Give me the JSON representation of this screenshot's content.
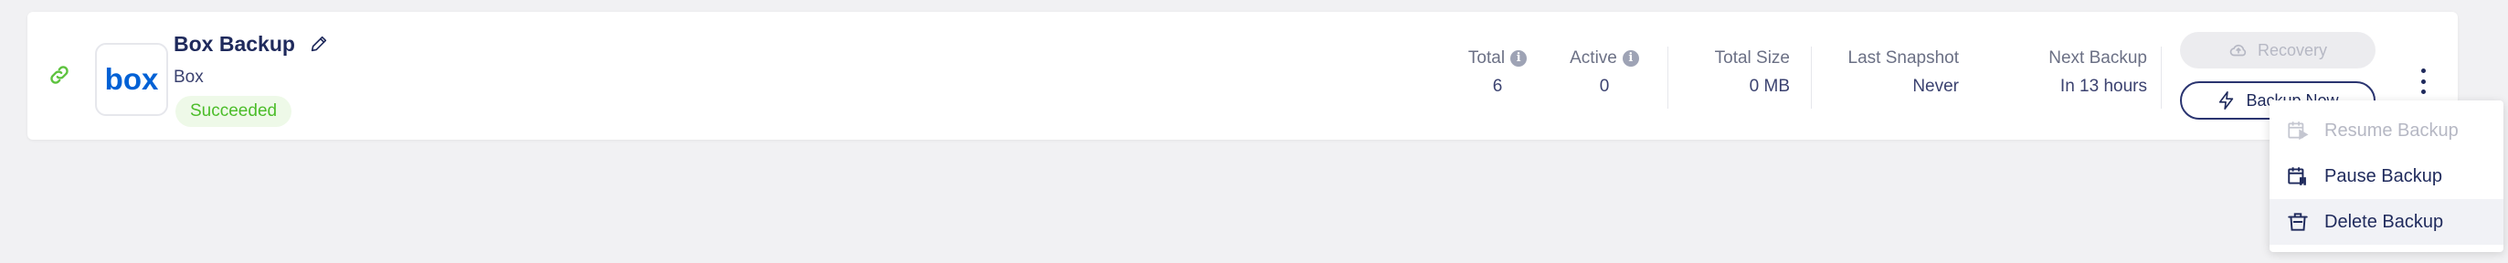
{
  "app": {
    "title": "Box Backup",
    "subtitle": "Box",
    "status": "Succeeded",
    "logo_text": "box"
  },
  "stats": {
    "total": {
      "label": "Total",
      "value": "6"
    },
    "active": {
      "label": "Active",
      "value": "0"
    },
    "total_size": {
      "label": "Total Size",
      "value": "0 MB"
    },
    "last_snapshot": {
      "label": "Last Snapshot",
      "value": "Never"
    },
    "next_backup": {
      "label": "Next Backup",
      "value": "In 13 hours"
    }
  },
  "actions": {
    "recovery_label": "Recovery",
    "backup_now_label": "Backup Now"
  },
  "menu": {
    "items": [
      {
        "label": "Resume Backup",
        "icon": "resume-icon",
        "disabled": true
      },
      {
        "label": "Pause Backup",
        "icon": "pause-icon",
        "disabled": false
      },
      {
        "label": "Delete Backup",
        "icon": "delete-icon",
        "disabled": false
      }
    ]
  },
  "colors": {
    "brand_navy": "#1f2a5c",
    "box_blue": "#0061d5",
    "success_green": "#4cbd2a",
    "link_green": "#5ec33f"
  }
}
